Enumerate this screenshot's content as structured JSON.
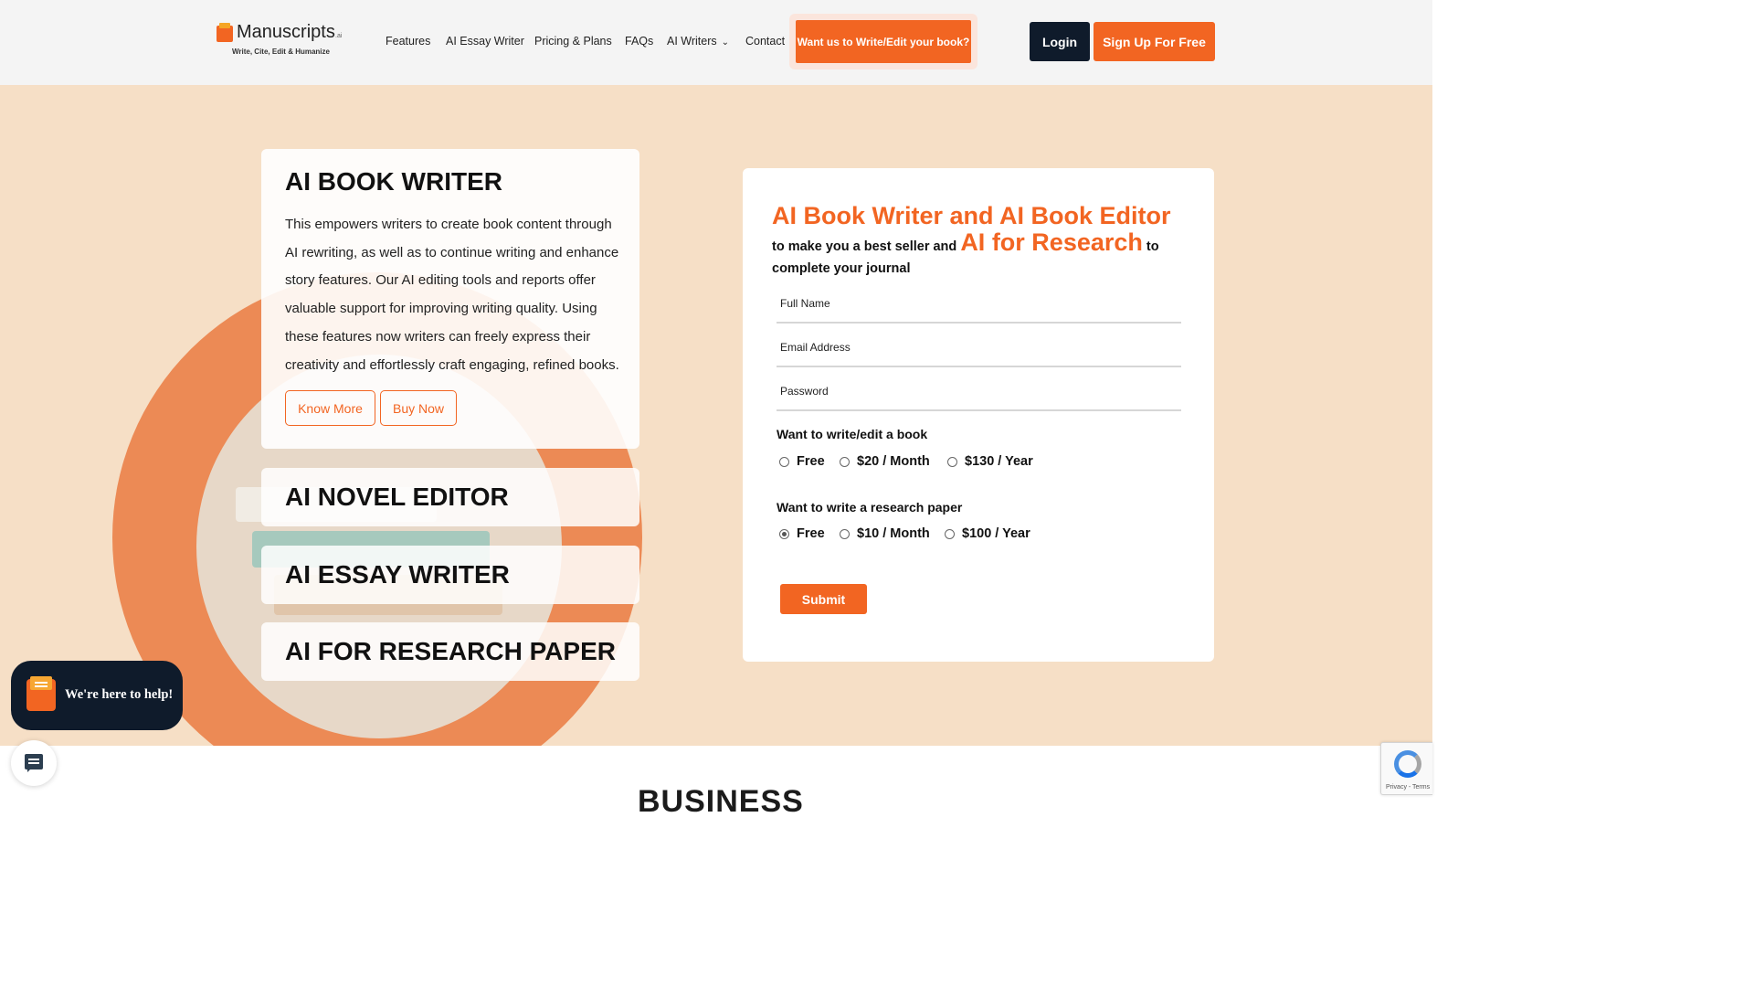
{
  "brand": {
    "name": "Manuscripts",
    "suffix": ".ai",
    "tagline": "Write, Cite, Edit & Humanize"
  },
  "nav": {
    "items": [
      "Features",
      "AI Essay Writer",
      "Pricing & Plans",
      "FAQs",
      "AI Writers",
      "Contact"
    ],
    "cta": "Want us to Write/Edit your book?",
    "login": "Login",
    "signup": "Sign Up For Free"
  },
  "accordion": {
    "active": {
      "title": "AI BOOK WRITER",
      "description": "This empowers writers to create book content through AI rewriting, as well as to continue writing and enhance story features. Our AI editing tools and reports offer valuable support for improving writing quality. Using these features now writers can freely express their creativity and effortlessly craft engaging, refined books.",
      "know_more": "Know More",
      "buy_now": "Buy Now"
    },
    "items": [
      "AI NOVEL EDITOR",
      "AI ESSAY WRITER",
      "AI FOR RESEARCH PAPER"
    ]
  },
  "form": {
    "heading_1": "AI Book Writer and AI Book Editor",
    "heading_2": " to make you a best seller and ",
    "heading_3": "AI for Research",
    "heading_4": " to complete your journal",
    "fields": {
      "full_name": "Full Name",
      "email": "Email Address",
      "password": "Password"
    },
    "book_question": "Want to write/edit a book",
    "book_options": [
      "Free",
      "$20 / Month",
      "$130 / Year"
    ],
    "book_selected": "",
    "research_question": "Want to write a research paper",
    "research_options": [
      "Free",
      "$10 / Month",
      "$100 / Year"
    ],
    "research_selected": "Free",
    "submit": "Submit"
  },
  "widgets": {
    "help_text": "We're here to help!",
    "recaptcha": "Privacy - Terms"
  },
  "next_section_heading": "BUSINESS",
  "colors": {
    "accent": "#f26522",
    "dark": "#0f1b2b",
    "hero_bg": "#f6dfc6",
    "header_bg": "#f4f4f4"
  },
  "icons": [
    "logo-icon",
    "chevron-down-icon",
    "help-chat-icon",
    "chat-icon",
    "recaptcha-icon"
  ]
}
